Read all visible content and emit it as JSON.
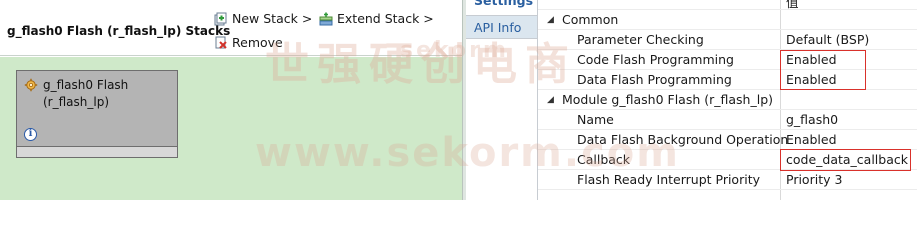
{
  "stacks": {
    "title": "g_flash0 Flash (r_flash_lp) Stacks",
    "new_stack_label": "New Stack >",
    "extend_stack_label": "Extend Stack >",
    "remove_label": "Remove",
    "module": {
      "name_line1": "g_flash0 Flash",
      "name_line2": "(r_flash_lp)",
      "icon": "module-gear-icon",
      "info_icon": "info-icon"
    }
  },
  "tabs": [
    {
      "label": "Settings",
      "selected": true
    },
    {
      "label": "API Info",
      "selected": false
    }
  ],
  "properties": {
    "header_value": "值",
    "common": {
      "label": "Common",
      "rows": [
        {
          "name": "Parameter Checking",
          "value": "Default (BSP)"
        },
        {
          "name": "Code Flash Programming",
          "value": "Enabled"
        },
        {
          "name": "Data Flash Programming",
          "value": "Enabled"
        }
      ]
    },
    "module": {
      "label": "Module g_flash0 Flash (r_flash_lp)",
      "rows": [
        {
          "name": "Name",
          "value": "g_flash0"
        },
        {
          "name": "Data Flash Background Operation",
          "value": "Enabled"
        },
        {
          "name": "Callback",
          "value": "code_data_callback"
        },
        {
          "name": "Flash Ready Interrupt Priority",
          "value": "Priority 3"
        }
      ]
    }
  },
  "watermark": {
    "text_cn": "世强硬创电商",
    "text_en": "www.sekorm.com",
    "text_brand": "sekorm"
  },
  "colors": {
    "canvas_green": "#cfe9c9",
    "highlight_red": "#d9312b",
    "tab_blue": "#2a5fa0"
  }
}
